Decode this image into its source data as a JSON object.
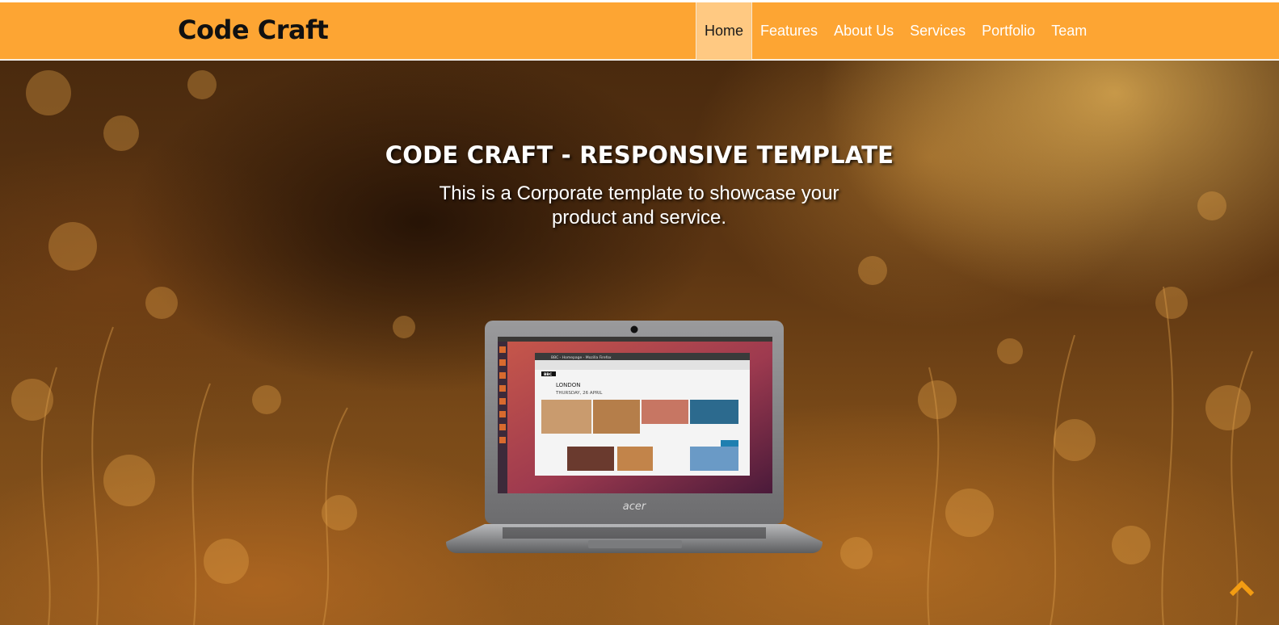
{
  "header": {
    "brand": "Code Craft",
    "nav_items": [
      {
        "label": "Home",
        "active": true
      },
      {
        "label": "Features",
        "active": false
      },
      {
        "label": "About Us",
        "active": false
      },
      {
        "label": "Services",
        "active": false
      },
      {
        "label": "Portfolio",
        "active": false
      },
      {
        "label": "Team",
        "active": false
      }
    ]
  },
  "hero": {
    "title": "CODE CRAFT - RESPONSIVE TEMPLATE",
    "subtitle": "This is a Corporate template to showcase your product and service.",
    "laptop": {
      "logo": "acer",
      "screen_window_title": "BBC - Homepage - Mozilla Firefox",
      "screen_location": "LONDON",
      "screen_date": "THURSDAY, 26 APRIL",
      "screen_site": "BBC"
    }
  },
  "scroll_top": {
    "icon": "chevron-up-icon"
  },
  "colors": {
    "navbar": "#fda533",
    "nav_active_bg": "#ffc982",
    "brand_text": "#111111",
    "accent": "#f39c12"
  }
}
